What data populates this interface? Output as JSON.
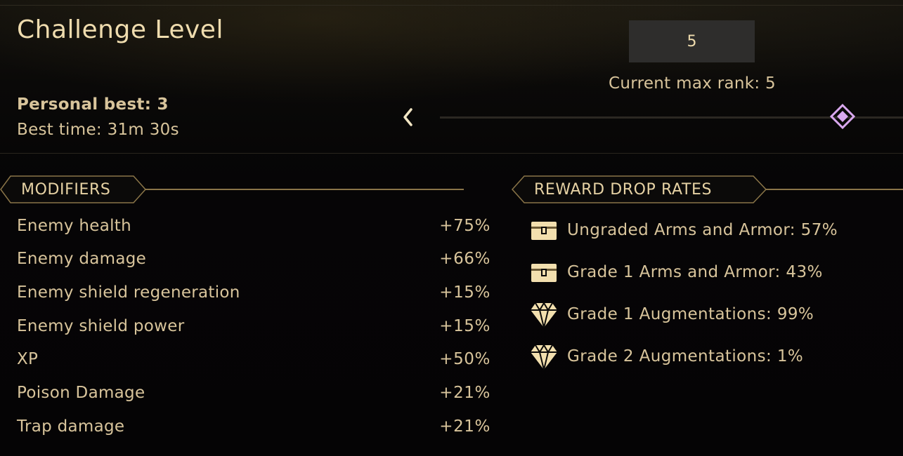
{
  "header": {
    "title": "Challenge Level",
    "personal_best": "Personal best: 3",
    "best_time": "Best time: 31m 30s",
    "selected_rank": "5",
    "current_max_rank": "Current max rank: 5",
    "slider": {
      "value": 5,
      "max": 5
    }
  },
  "modifiers": {
    "heading": "MODIFIERS",
    "items": [
      {
        "name": "Enemy health",
        "value": "+75%"
      },
      {
        "name": "Enemy damage",
        "value": "+66%"
      },
      {
        "name": "Enemy shield regeneration",
        "value": "+15%"
      },
      {
        "name": "Enemy shield power",
        "value": "+15%"
      },
      {
        "name": "XP",
        "value": "+50%"
      },
      {
        "name": "Poison Damage",
        "value": "+21%"
      },
      {
        "name": "Trap damage",
        "value": "+21%"
      }
    ]
  },
  "rewards": {
    "heading": "REWARD DROP RATES",
    "items": [
      {
        "icon": "chest-icon",
        "text": "Ungraded Arms and Armor: 57%"
      },
      {
        "icon": "chest-icon",
        "text": "Grade 1 Arms and Armor: 43%"
      },
      {
        "icon": "diamond-gem-icon",
        "text": "Grade 1 Augmentations: 99%"
      },
      {
        "icon": "diamond-gem-icon",
        "text": "Grade 2 Augmentations: 1%"
      }
    ]
  },
  "colors": {
    "text": "#d8c49b",
    "accent_gold": "#8a7548",
    "icon_gold": "#f2dfae",
    "slider_handle": "#d9a8ef",
    "background": "#050405"
  }
}
